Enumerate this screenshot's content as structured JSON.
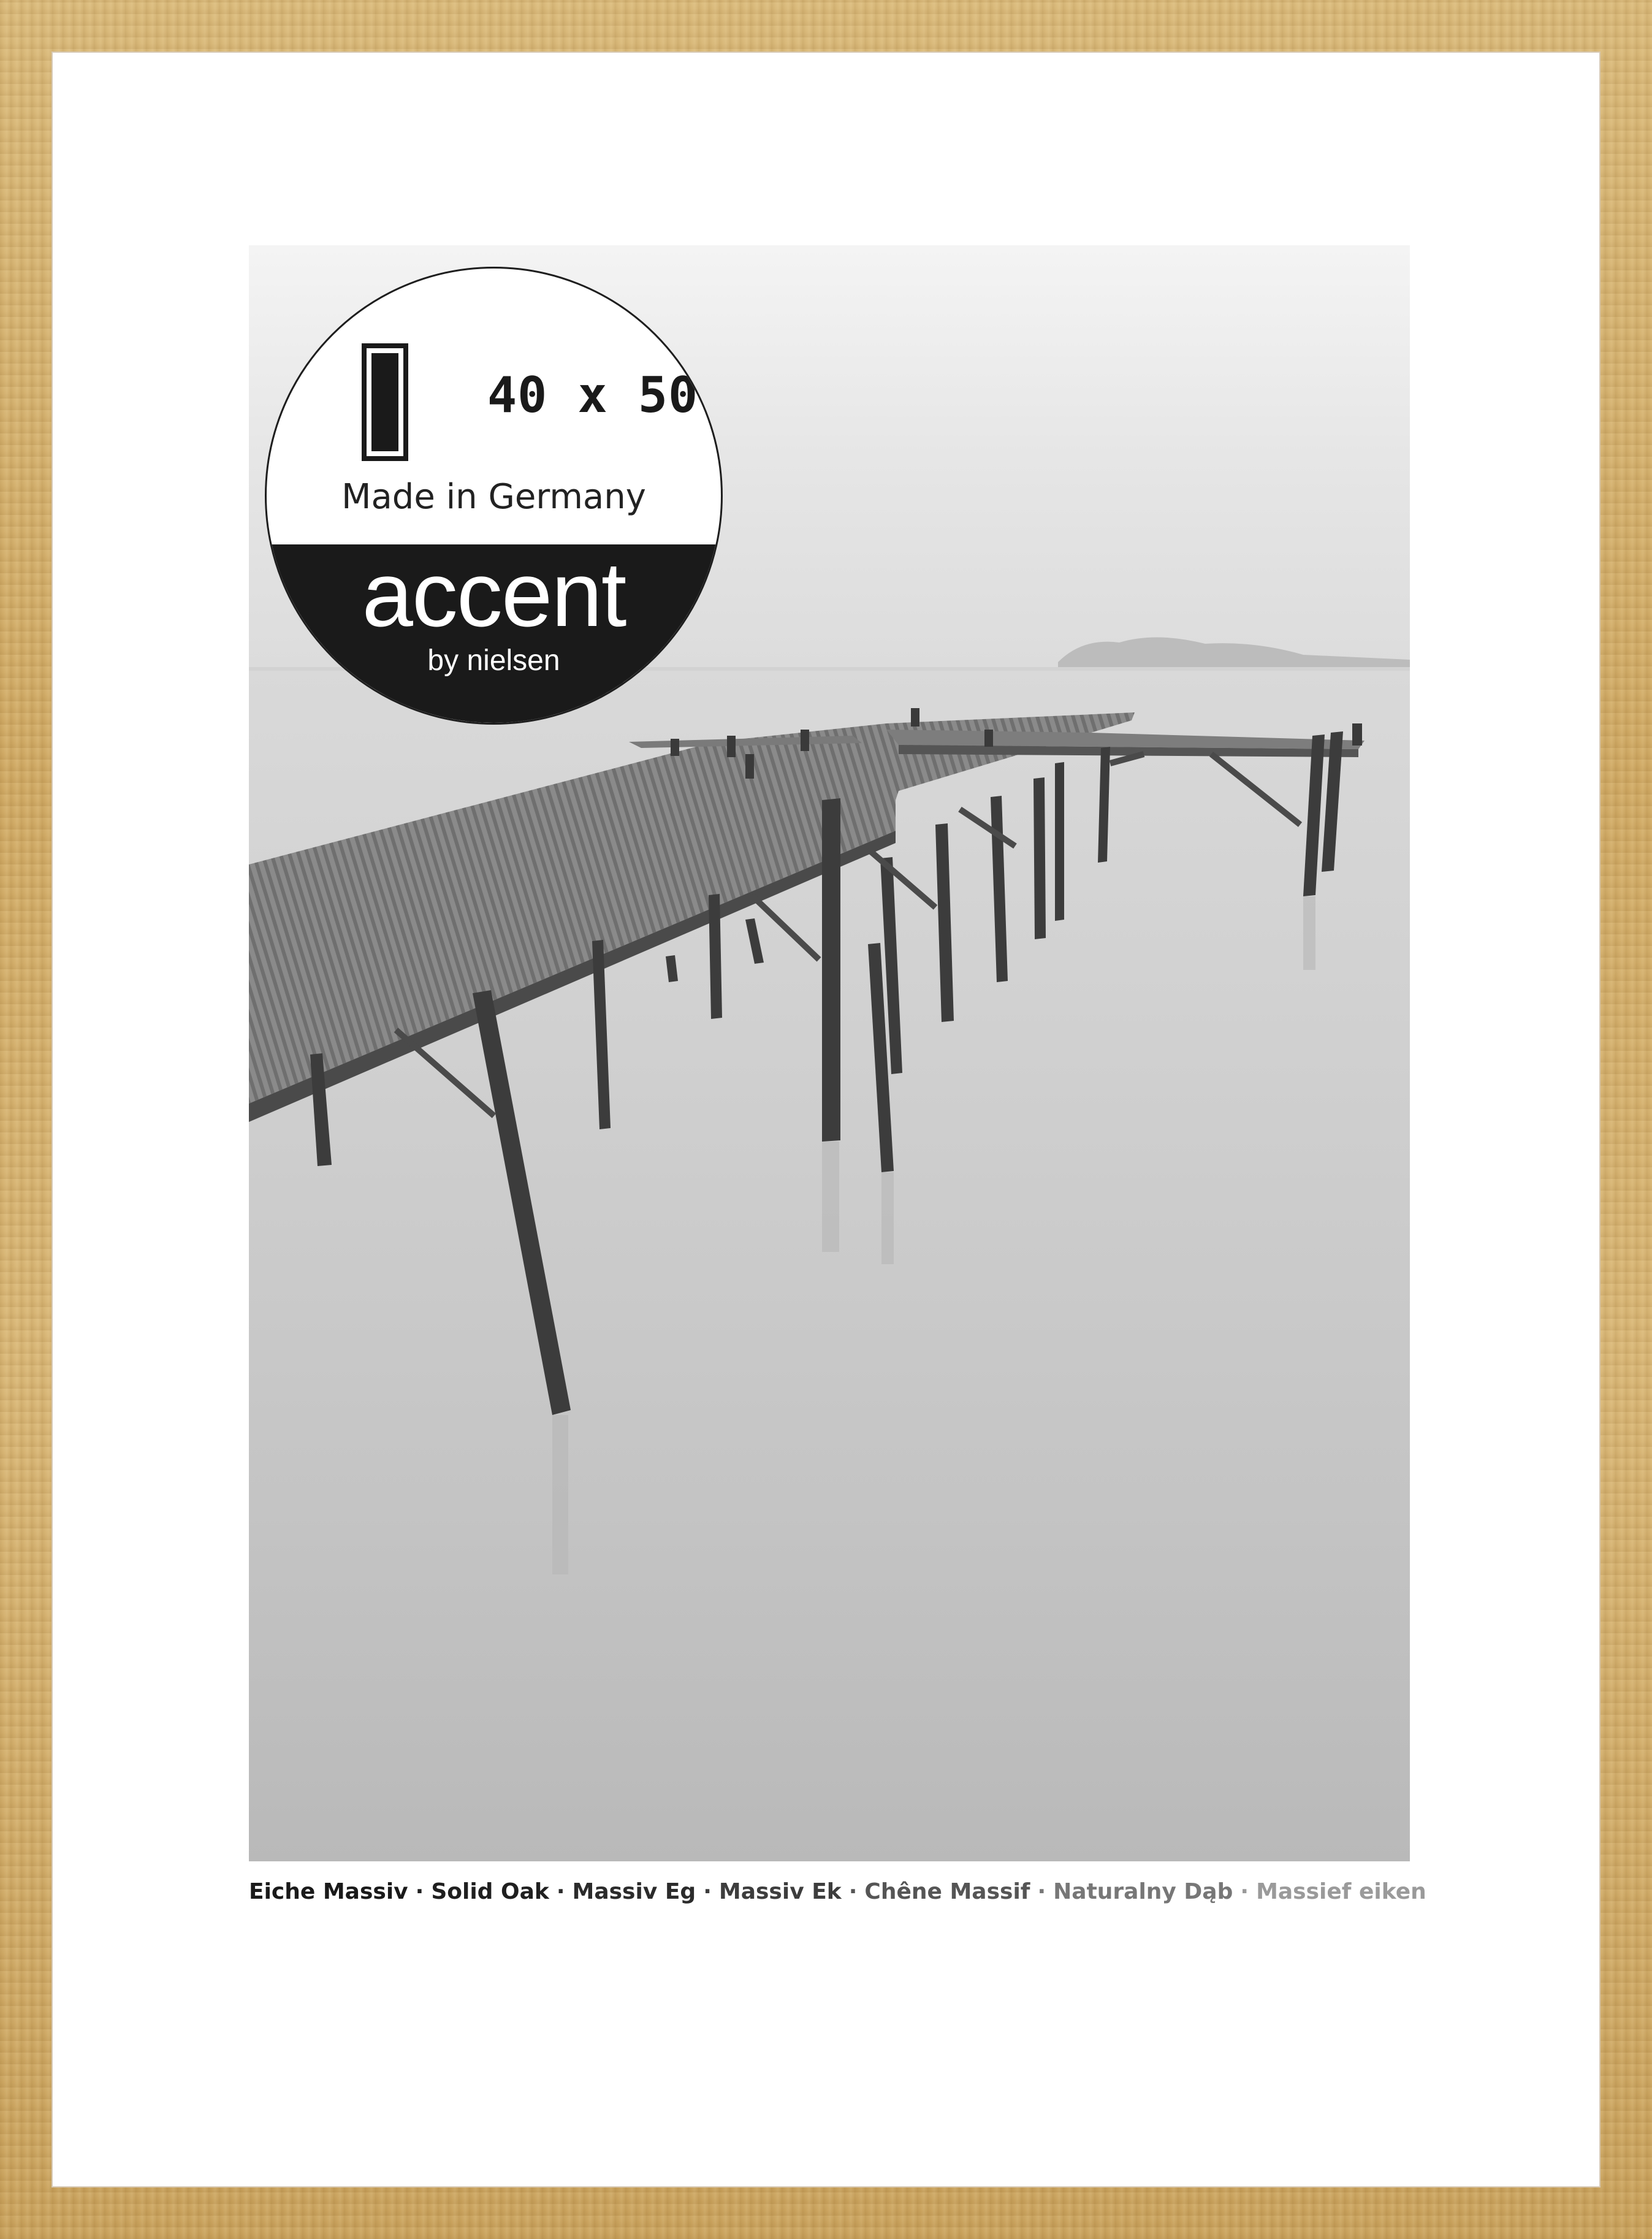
{
  "badge": {
    "size": "40 x 50",
    "made_in": "Made in Germany",
    "brand": "accent",
    "by": "by nielsen"
  },
  "caption": {
    "items": [
      {
        "text": "Eiche Massiv",
        "color": "#1a1a1a"
      },
      {
        "text": "Solid Oak",
        "color": "#1f1f1f"
      },
      {
        "text": "Massiv Eg",
        "color": "#2b2b2b"
      },
      {
        "text": "Massiv Ek",
        "color": "#3d3d3d"
      },
      {
        "text": "Chêne Massif",
        "color": "#555555"
      },
      {
        "text": "Naturalny Dąb",
        "color": "#777777"
      },
      {
        "text": "Massief eiken",
        "color": "#9a9a9a"
      }
    ],
    "separator": "·"
  },
  "colors": {
    "frame_oak": "#d3b06c",
    "mat": "#ffffff",
    "badge_dark": "#1a1a1a"
  }
}
